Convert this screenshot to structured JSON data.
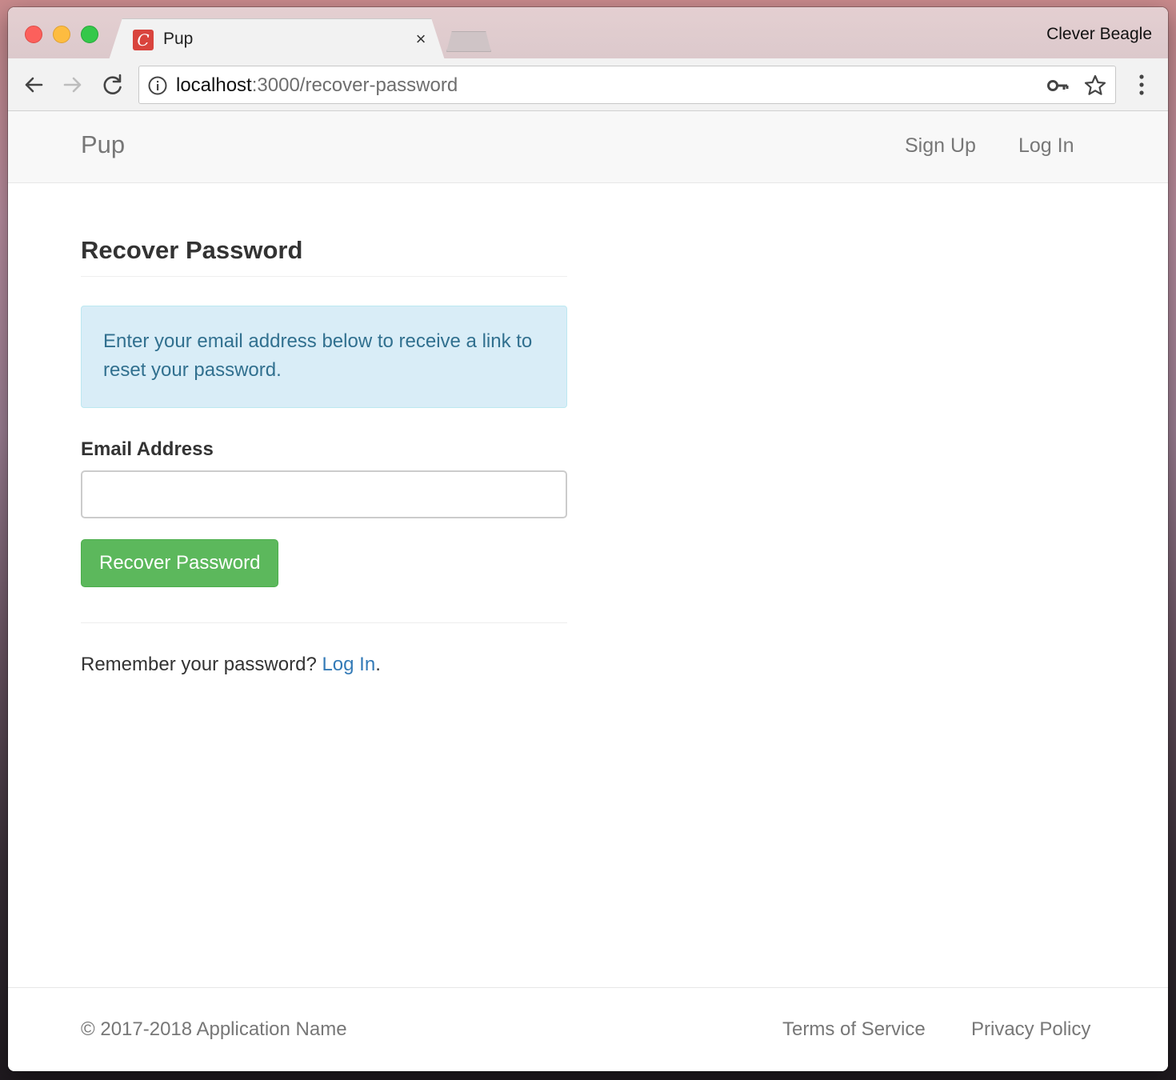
{
  "browser": {
    "tab_title": "Pup",
    "tab_favicon_letter": "C",
    "tab_close": "×",
    "profile_name": "Clever Beagle",
    "url_host": "localhost",
    "url_path": ":3000/recover-password"
  },
  "navbar": {
    "brand": "Pup",
    "signup": "Sign Up",
    "login": "Log In"
  },
  "page": {
    "title": "Recover Password",
    "alert": "Enter your email address below to receive a link to reset your password.",
    "email_label": "Email Address",
    "email_value": "",
    "submit_label": "Recover Password",
    "remember_text": "Remember your password? ",
    "remember_link": "Log In",
    "remember_period": "."
  },
  "footer": {
    "copyright": "© 2017-2018 Application Name",
    "terms": "Terms of Service",
    "privacy": "Privacy Policy"
  },
  "icons": {
    "back": "arrow-left-icon",
    "forward": "arrow-right-icon",
    "reload": "reload-icon",
    "info": "info-icon",
    "key": "key-icon",
    "star": "star-icon",
    "menu": "more-vertical-icon"
  },
  "colors": {
    "alert_bg": "#d9edf7",
    "alert_text": "#31708f",
    "button_success": "#5cb85c",
    "link": "#337ab7",
    "favicon": "#d9443d"
  }
}
